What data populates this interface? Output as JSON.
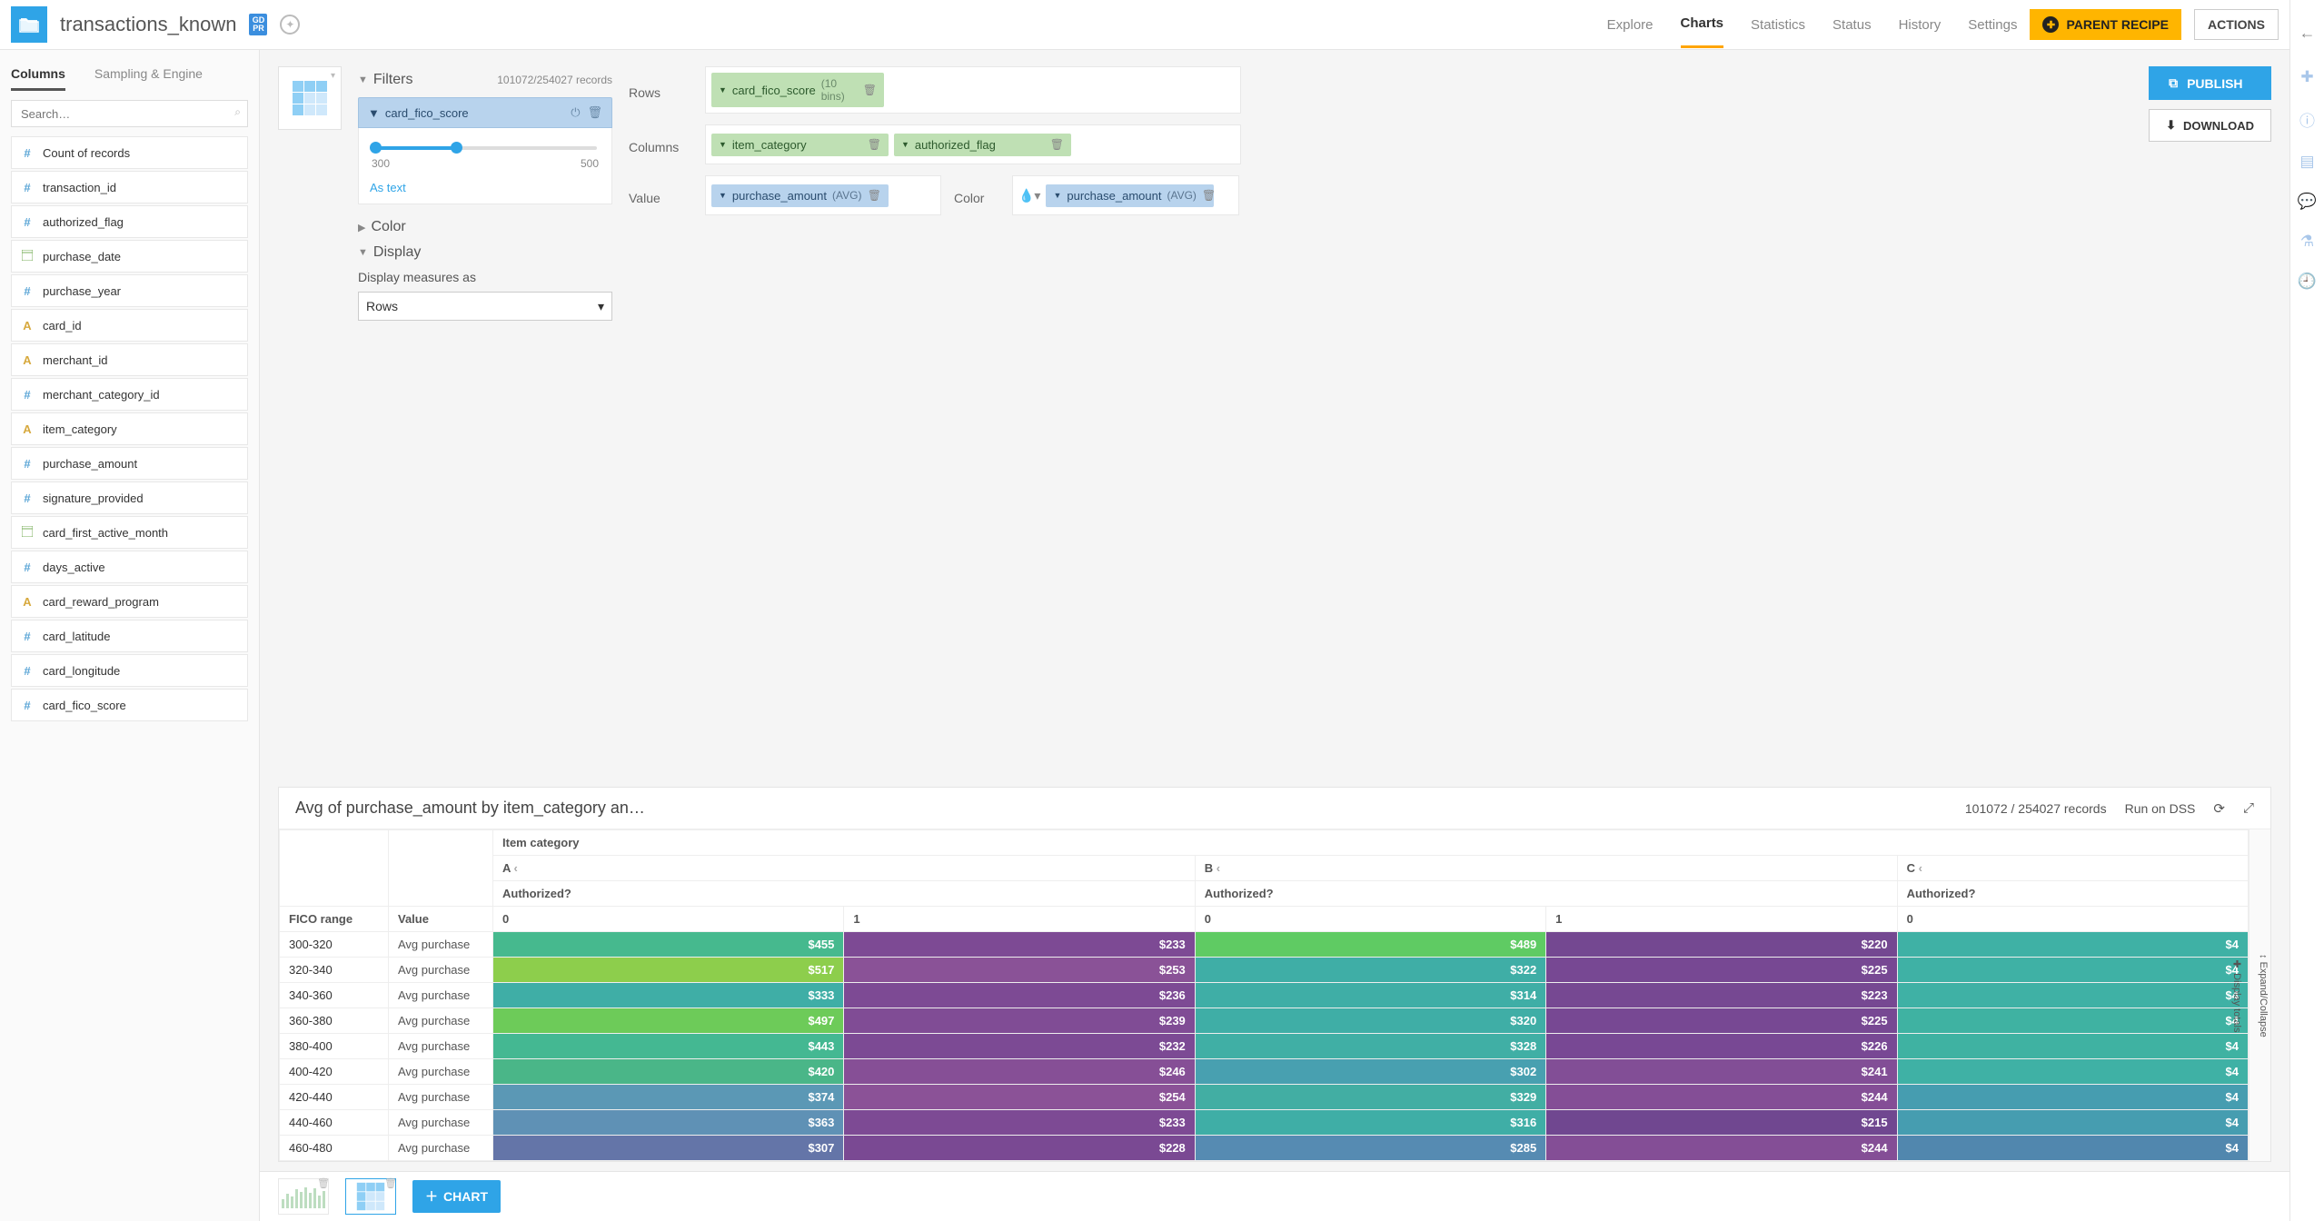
{
  "header": {
    "dataset": "transactions_known",
    "badge": "GD\nPR",
    "tabs": [
      "Explore",
      "Charts",
      "Statistics",
      "Status",
      "History",
      "Settings"
    ],
    "active_tab_index": 1,
    "parent_recipe": "PARENT RECIPE",
    "actions": "ACTIONS"
  },
  "left": {
    "tabs": [
      "Columns",
      "Sampling & Engine"
    ],
    "search_placeholder": "Search…",
    "columns": [
      {
        "t": "num",
        "n": "Count of records"
      },
      {
        "t": "num",
        "n": "transaction_id"
      },
      {
        "t": "num",
        "n": "authorized_flag"
      },
      {
        "t": "date",
        "n": "purchase_date"
      },
      {
        "t": "num",
        "n": "purchase_year"
      },
      {
        "t": "a",
        "n": "card_id"
      },
      {
        "t": "a",
        "n": "merchant_id"
      },
      {
        "t": "num",
        "n": "merchant_category_id"
      },
      {
        "t": "a",
        "n": "item_category"
      },
      {
        "t": "num",
        "n": "purchase_amount"
      },
      {
        "t": "num",
        "n": "signature_provided"
      },
      {
        "t": "date",
        "n": "card_first_active_month"
      },
      {
        "t": "num",
        "n": "days_active"
      },
      {
        "t": "a",
        "n": "card_reward_program"
      },
      {
        "t": "num",
        "n": "card_latitude"
      },
      {
        "t": "num",
        "n": "card_longitude"
      },
      {
        "t": "num",
        "n": "card_fico_score"
      }
    ]
  },
  "shelves": {
    "rows_lbl": "Rows",
    "cols_lbl": "Columns",
    "value_lbl": "Value",
    "color_lbl": "Color",
    "rows": [
      {
        "name": "card_fico_score",
        "suffix": "(10 bins)"
      }
    ],
    "cols": [
      {
        "name": "item_category"
      },
      {
        "name": "authorized_flag"
      }
    ],
    "values": [
      {
        "name": "purchase_amount",
        "agg": "(AVG)"
      }
    ],
    "colors": [
      {
        "name": "purchase_amount",
        "agg": "(AVG)"
      }
    ]
  },
  "actions": {
    "publish": "PUBLISH",
    "download": "DOWNLOAD"
  },
  "side": {
    "filters_hd": "Filters",
    "filters_records": "101072/254027 records",
    "filter_name": "card_fico_score",
    "range_min": "300",
    "range_max": "500",
    "as_text": "As text",
    "color_hd": "Color",
    "display_hd": "Display",
    "display_lbl": "Display measures as",
    "display_value": "Rows"
  },
  "table": {
    "title": "Avg of purchase_amount by item_category an…",
    "records": "101072 / 254027 records",
    "run": "Run on DSS",
    "col_group": "Item category",
    "auth": "Authorized?",
    "subcols": [
      "0",
      "1",
      "0",
      "1",
      "0"
    ],
    "cats": [
      "A",
      "B",
      "C"
    ],
    "row_hd": "FICO range",
    "val_hd": "Value",
    "measure": "Avg purchase",
    "expand": "Expand/Collapse",
    "totals": "Display totals"
  },
  "bottom": {
    "chart": "CHART"
  },
  "chart_data": {
    "type": "table",
    "title": "Avg of purchase_amount by item_category and authorized_flag",
    "row_dimension": "card_fico_score (10 bins)",
    "col_dimensions": [
      "item_category",
      "authorized_flag"
    ],
    "measure": "Avg purchase_amount",
    "columns": [
      "A|0",
      "A|1",
      "B|0",
      "B|1",
      "C|0"
    ],
    "rows": [
      {
        "label": "300-320",
        "v": [
          455,
          233,
          489,
          220,
          null
        ],
        "colors": [
          "#46b98e",
          "#7d4a94",
          "#5fcb63",
          "#744891",
          "#3fb1a5"
        ]
      },
      {
        "label": "320-340",
        "v": [
          517,
          253,
          322,
          225,
          null
        ],
        "colors": [
          "#8dce4c",
          "#8a5297",
          "#3faea6",
          "#774893",
          "#3fb1a5"
        ]
      },
      {
        "label": "340-360",
        "v": [
          333,
          236,
          314,
          223,
          null
        ],
        "colors": [
          "#3faea6",
          "#7d4a94",
          "#3faea6",
          "#764892",
          "#3fb1a5"
        ]
      },
      {
        "label": "360-380",
        "v": [
          497,
          239,
          320,
          225,
          null
        ],
        "colors": [
          "#6dcb59",
          "#804c95",
          "#3faea6",
          "#774893",
          "#3fb2a2"
        ]
      },
      {
        "label": "380-400",
        "v": [
          443,
          232,
          328,
          226,
          null
        ],
        "colors": [
          "#44b892",
          "#7c4a94",
          "#40afa5",
          "#784894",
          "#3fb2a2"
        ]
      },
      {
        "label": "400-420",
        "v": [
          420,
          246,
          302,
          241,
          null
        ],
        "colors": [
          "#4ab688",
          "#864f96",
          "#48a0b0",
          "#824e96",
          "#3fb1a5"
        ]
      },
      {
        "label": "420-440",
        "v": [
          374,
          254,
          329,
          244,
          null
        ],
        "colors": [
          "#5b98b5",
          "#8b5297",
          "#42aea3",
          "#844e96",
          "#469db0"
        ]
      },
      {
        "label": "440-460",
        "v": [
          363,
          233,
          316,
          215,
          null
        ],
        "colors": [
          "#5f91b5",
          "#7d4a94",
          "#3faea6",
          "#704790",
          "#469db0"
        ]
      },
      {
        "label": "460-480",
        "v": [
          307,
          228,
          285,
          244,
          null
        ],
        "colors": [
          "#6475a8",
          "#7a4993",
          "#568bb2",
          "#844e96",
          "#5187ae"
        ]
      }
    ]
  }
}
